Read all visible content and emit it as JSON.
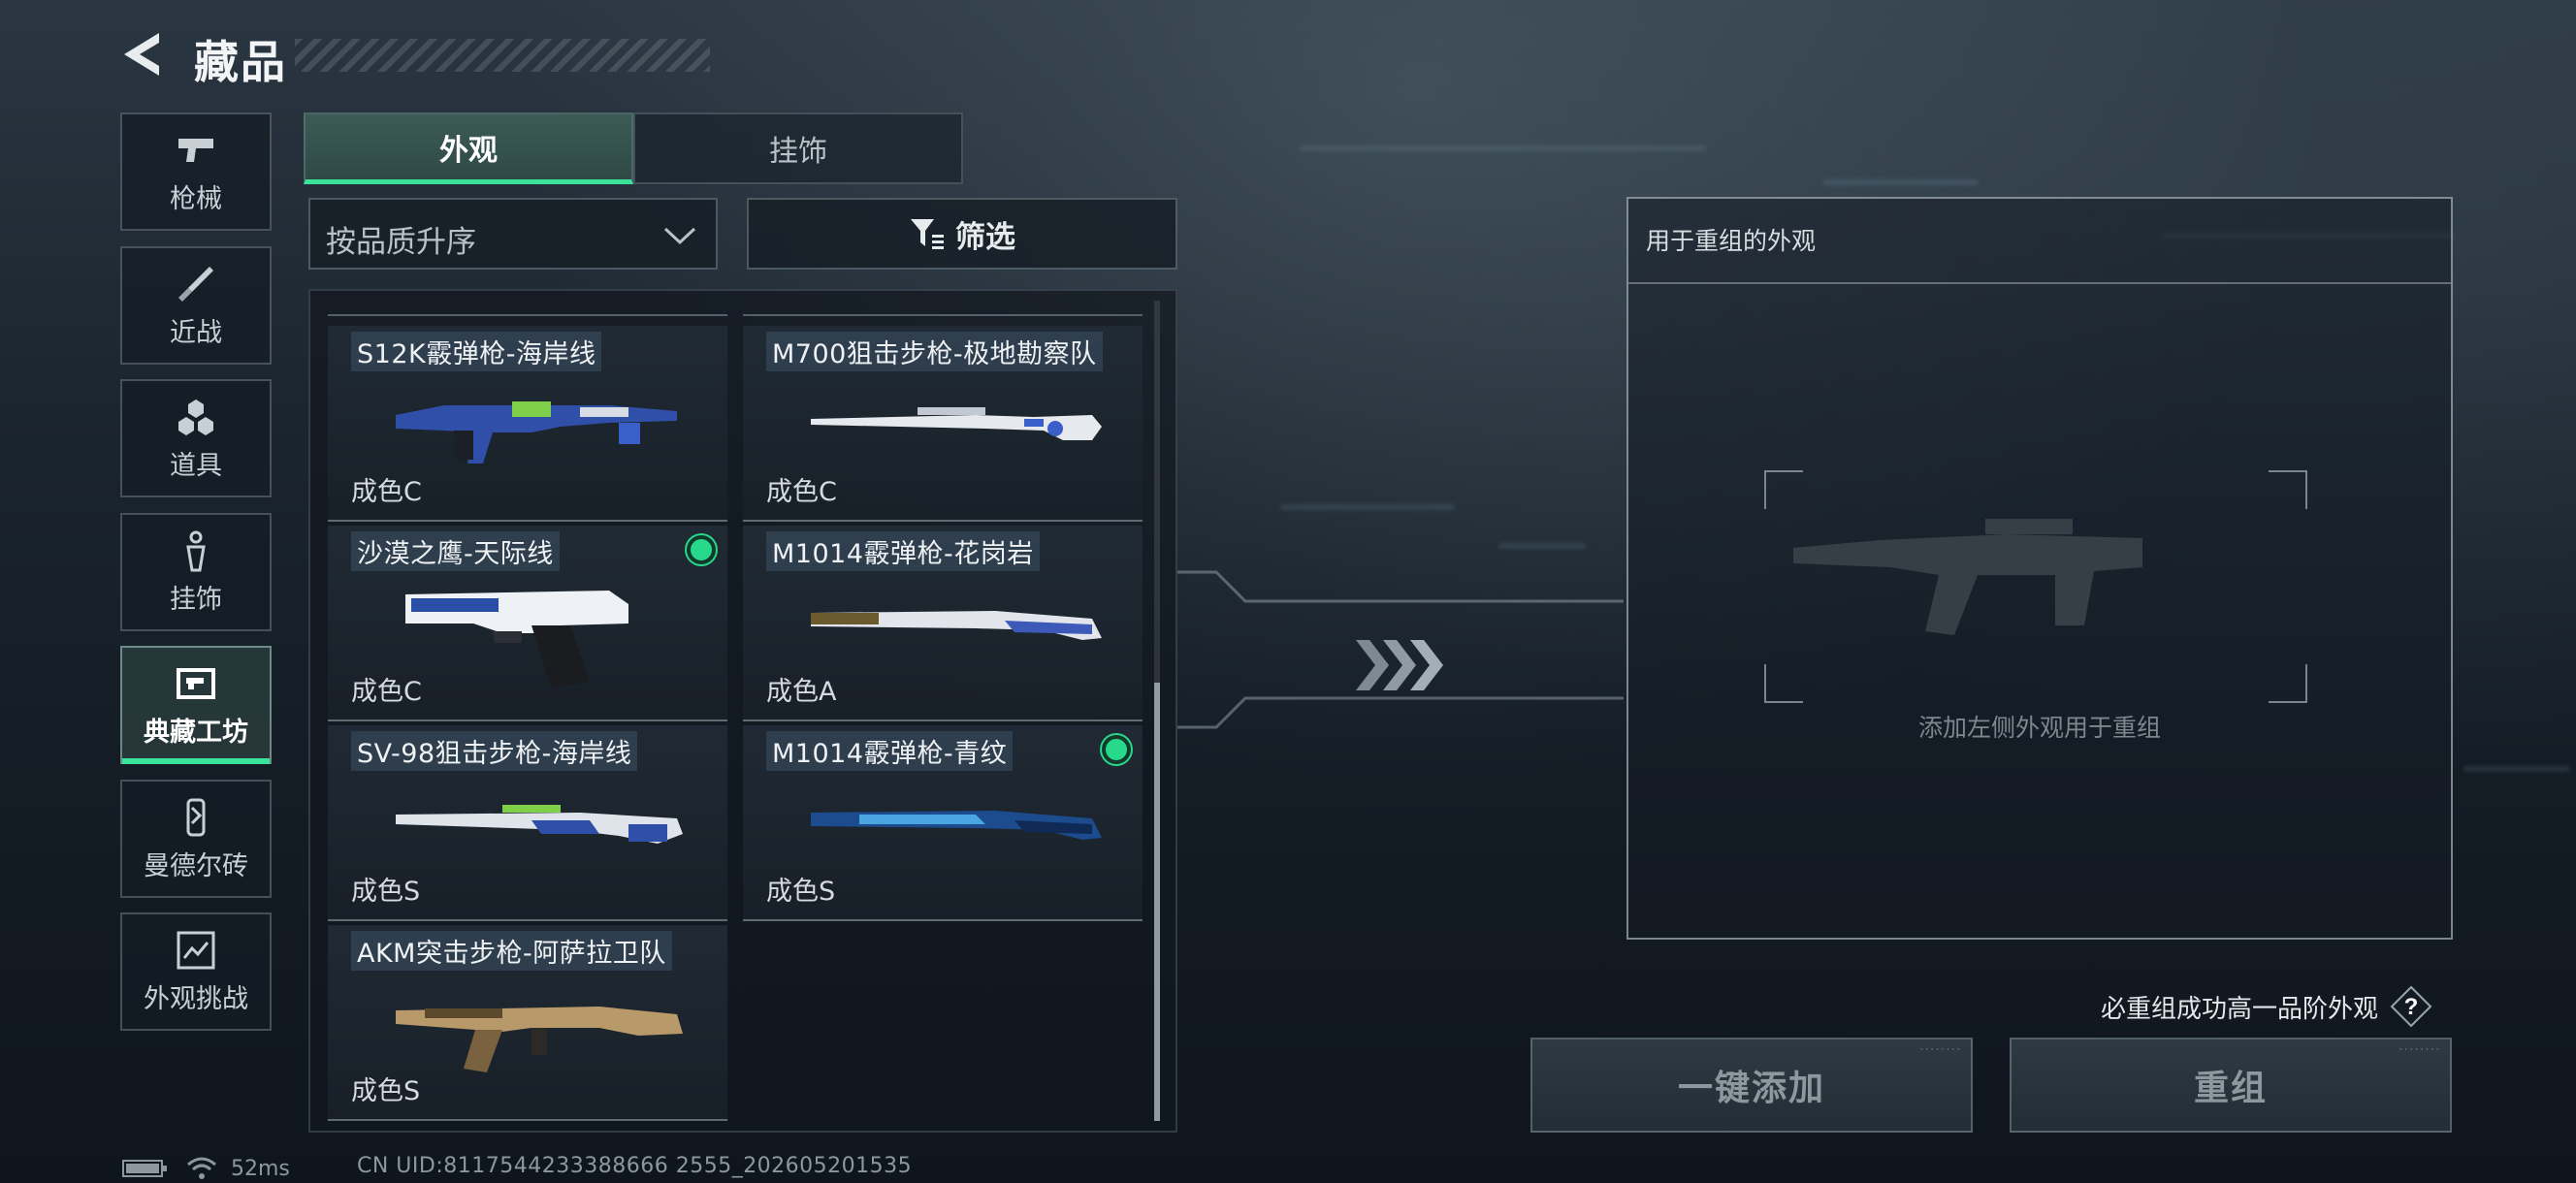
{
  "header": {
    "title": "藏品"
  },
  "sidebar": {
    "items": [
      {
        "label": "枪械",
        "icon": "pistol-icon"
      },
      {
        "label": "近战",
        "icon": "knife-icon"
      },
      {
        "label": "道具",
        "icon": "grenades-icon"
      },
      {
        "label": "挂饰",
        "icon": "charm-icon"
      },
      {
        "label": "典藏工坊",
        "icon": "workshop-icon",
        "active": true
      },
      {
        "label": "曼德尔砖",
        "icon": "brick-icon"
      },
      {
        "label": "外观挑战",
        "icon": "challenge-icon"
      }
    ]
  },
  "tabs": [
    {
      "label": "外观",
      "active": true
    },
    {
      "label": "挂饰",
      "active": false
    }
  ],
  "sort": {
    "selected": "按品质升序"
  },
  "filter": {
    "label": "筛选"
  },
  "skins": [
    {
      "name": "S12K霰弹枪-海岸线",
      "grade": "成色C",
      "owned": false
    },
    {
      "name": "M700狙击步枪-极地勘察队",
      "grade": "成色C",
      "owned": false
    },
    {
      "name": "沙漠之鹰-天际线",
      "grade": "成色C",
      "owned": true
    },
    {
      "name": "M1014霰弹枪-花岗岩",
      "grade": "成色A",
      "owned": false
    },
    {
      "name": "SV-98狙击步枪-海岸线",
      "grade": "成色S",
      "owned": false
    },
    {
      "name": "M1014霰弹枪-青纹",
      "grade": "成色S",
      "owned": true
    },
    {
      "name": "AKM突击步枪-阿萨拉卫队",
      "grade": "成色S",
      "owned": false
    }
  ],
  "reassembly": {
    "title": "用于重组的外观",
    "hint": "添加左侧外观用于重组"
  },
  "guarantee": {
    "text": "必重组成功高一品阶外观"
  },
  "actions": {
    "quick_add": "一键添加",
    "reassemble": "重组"
  },
  "status": {
    "ping": "52ms",
    "uid": "CN UID:8117544233388666 2555_202605201535"
  },
  "colors": {
    "accent": "#3be39a",
    "owned_dot": "#27d98b"
  }
}
